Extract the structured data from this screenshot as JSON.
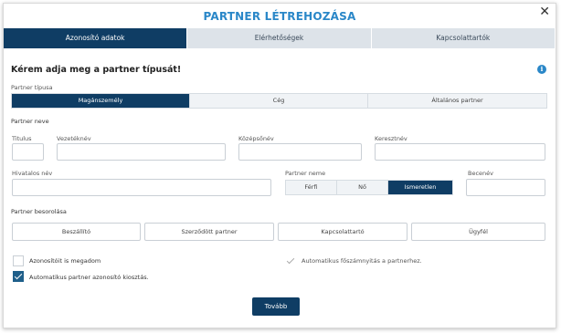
{
  "dialog": {
    "title": "PARTNER LÉTREHOZÁSA",
    "close": "✕"
  },
  "tabs": [
    {
      "label": "Azonosító adatok",
      "active": true
    },
    {
      "label": "Elérhetőségek",
      "active": false
    },
    {
      "label": "Kapcsolattartók",
      "active": false
    }
  ],
  "form": {
    "heading": "Kérem adja meg a partner típusát!",
    "info_icon": "i",
    "partner_type": {
      "label": "Partner típusa",
      "options": [
        "Magánszemély",
        "Cég",
        "Általános partner"
      ],
      "selected": "Magánszemély"
    },
    "partner_name": {
      "section_label": "Partner neve",
      "titulus": "Titulus",
      "vezeteknev": "Vezetéknév",
      "kozepsonev": "Középsőnév",
      "keresztnev": "Keresztnév"
    },
    "official_name": {
      "label": "Hivatalos név",
      "value": ""
    },
    "gender": {
      "label": "Partner neme",
      "options": [
        "Férfi",
        "Nő",
        "Ismeretlen"
      ],
      "selected": "Ismeretlen"
    },
    "nickname": {
      "label": "Becenév",
      "value": ""
    },
    "classification": {
      "label": "Partner besorolása",
      "options": [
        "Beszállító",
        "Szerződött partner",
        "Kapcsolattartó",
        "Ügyfél"
      ]
    },
    "checkboxes": {
      "own_ids": "Azonosítóit is megadom",
      "auto_ledger": "Automatikus főszámnyitás a partnerhez.",
      "auto_partner_id": "Automatikus partner azonosító kiosztás."
    },
    "next_button": "Tovább"
  }
}
